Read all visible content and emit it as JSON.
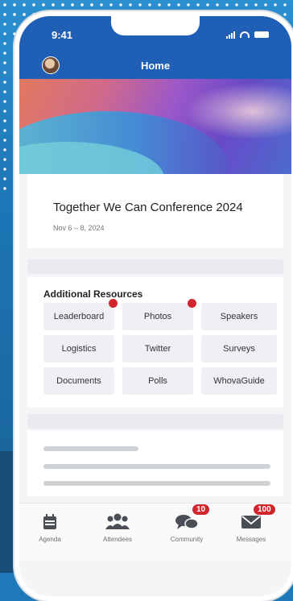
{
  "status_bar": {
    "time": "9:41"
  },
  "header": {
    "title": "Home"
  },
  "event": {
    "name": "Together We Can Conference 2024",
    "dates": "Nov 6 – 8, 2024"
  },
  "resources": {
    "heading": "Additional Resources",
    "items": [
      {
        "label": "Leaderboard",
        "notification": true
      },
      {
        "label": "Photos",
        "notification": true
      },
      {
        "label": "Speakers",
        "notification": false
      },
      {
        "label": "Logistics",
        "notification": false
      },
      {
        "label": "Twitter",
        "notification": false
      },
      {
        "label": "Surveys",
        "notification": false
      },
      {
        "label": "Documents",
        "notification": false
      },
      {
        "label": "Polls",
        "notification": false
      },
      {
        "label": "WhovaGuide",
        "notification": false
      }
    ]
  },
  "tabbar": {
    "items": [
      {
        "label": "Agenda",
        "icon": "calendar-icon"
      },
      {
        "label": "Attendees",
        "icon": "people-icon"
      },
      {
        "label": "Community",
        "icon": "chat-icon",
        "badge": "10"
      },
      {
        "label": "Messages",
        "icon": "mail-icon",
        "badge": "100"
      }
    ]
  },
  "colors": {
    "primary": "#1f5fb5",
    "badge": "#d2262e",
    "background": "#1e79b8"
  }
}
